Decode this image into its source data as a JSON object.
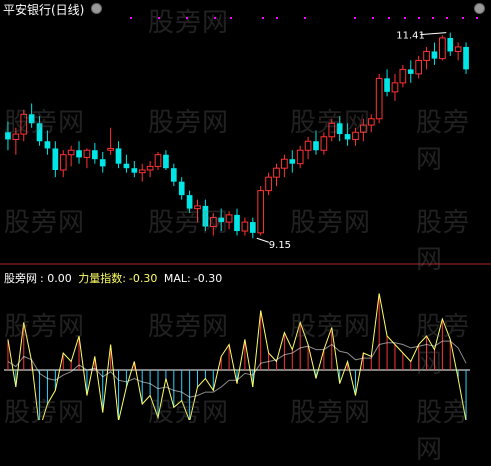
{
  "header": {
    "title": "平安银行(日线)",
    "watermark": "股旁网",
    "high_label": "11.41",
    "low_label": "9.15"
  },
  "indicator_bar": {
    "name": "股旁网",
    "value_text": ": 0.00",
    "force_label": "力量指数:",
    "force_value": "-0.30",
    "mal_label": "MAL:",
    "mal_value": "-0.30"
  },
  "colors": {
    "background": "#000000",
    "up_candle": "#ff3333",
    "down_candle": "#00e5e5",
    "divider": "#b22222",
    "dotted_top": "#ff00ff",
    "force_line": "#ffff66",
    "force_bar_up": "#ff3333",
    "force_bar_down": "#2ad2ff"
  },
  "chart_data": [
    {
      "type": "candlestick",
      "title": "平安银行(日线)",
      "price_range": [
        8.9,
        11.55
      ],
      "annotations": [
        {
          "text": "11.41",
          "index": 56
        },
        {
          "text": "9.15",
          "index": 31
        }
      ],
      "ohlc": [
        [
          10.3,
          10.42,
          10.1,
          10.22
        ],
        [
          10.22,
          10.35,
          10.05,
          10.28
        ],
        [
          10.28,
          10.55,
          10.2,
          10.5
        ],
        [
          10.5,
          10.62,
          10.35,
          10.4
        ],
        [
          10.4,
          10.48,
          10.15,
          10.2
        ],
        [
          10.2,
          10.32,
          10.05,
          10.12
        ],
        [
          10.12,
          10.2,
          9.8,
          9.88
        ],
        [
          9.88,
          10.1,
          9.8,
          10.05
        ],
        [
          10.05,
          10.15,
          9.92,
          10.1
        ],
        [
          10.1,
          10.2,
          9.95,
          10.02
        ],
        [
          10.02,
          10.12,
          9.9,
          10.1
        ],
        [
          10.1,
          10.18,
          9.95,
          10.0
        ],
        [
          10.0,
          10.08,
          9.85,
          9.92
        ],
        [
          10.1,
          10.35,
          10.05,
          10.12
        ],
        [
          10.12,
          10.2,
          9.9,
          9.95
        ],
        [
          9.95,
          10.05,
          9.85,
          9.9
        ],
        [
          9.9,
          9.98,
          9.8,
          9.85
        ],
        [
          9.85,
          9.95,
          9.75,
          9.88
        ],
        [
          9.88,
          9.98,
          9.8,
          9.92
        ],
        [
          9.92,
          10.08,
          9.88,
          10.05
        ],
        [
          10.05,
          10.1,
          9.88,
          9.9
        ],
        [
          9.9,
          9.95,
          9.7,
          9.75
        ],
        [
          9.75,
          9.8,
          9.55,
          9.6
        ],
        [
          9.6,
          9.65,
          9.4,
          9.45
        ],
        [
          9.45,
          9.55,
          9.3,
          9.48
        ],
        [
          9.48,
          9.55,
          9.2,
          9.25
        ],
        [
          9.25,
          9.4,
          9.15,
          9.35
        ],
        [
          9.35,
          9.45,
          9.2,
          9.3
        ],
        [
          9.3,
          9.42,
          9.22,
          9.38
        ],
        [
          9.38,
          9.45,
          9.15,
          9.2
        ],
        [
          9.2,
          9.35,
          9.15,
          9.3
        ],
        [
          9.3,
          9.35,
          9.12,
          9.18
        ],
        [
          9.18,
          9.7,
          9.15,
          9.65
        ],
        [
          9.65,
          9.85,
          9.6,
          9.8
        ],
        [
          9.8,
          9.95,
          9.7,
          9.9
        ],
        [
          9.9,
          10.05,
          9.8,
          10.0
        ],
        [
          10.0,
          10.1,
          9.85,
          9.95
        ],
        [
          9.95,
          10.15,
          9.9,
          10.1
        ],
        [
          10.1,
          10.25,
          10.0,
          10.2
        ],
        [
          10.2,
          10.32,
          10.05,
          10.1
        ],
        [
          10.1,
          10.3,
          10.05,
          10.25
        ],
        [
          10.25,
          10.45,
          10.2,
          10.4
        ],
        [
          10.4,
          10.48,
          10.2,
          10.28
        ],
        [
          10.28,
          10.4,
          10.15,
          10.22
        ],
        [
          10.22,
          10.35,
          10.15,
          10.3
        ],
        [
          10.3,
          10.45,
          10.2,
          10.38
        ],
        [
          10.38,
          10.5,
          10.3,
          10.45
        ],
        [
          10.45,
          10.95,
          10.4,
          10.9
        ],
        [
          10.9,
          11.0,
          10.7,
          10.75
        ],
        [
          10.75,
          10.95,
          10.65,
          10.85
        ],
        [
          10.85,
          11.05,
          10.8,
          11.0
        ],
        [
          11.0,
          11.1,
          10.85,
          10.95
        ],
        [
          10.95,
          11.15,
          10.9,
          11.1
        ],
        [
          11.1,
          11.25,
          11.0,
          11.2
        ],
        [
          11.2,
          11.3,
          11.05,
          11.12
        ],
        [
          11.12,
          11.38,
          11.1,
          11.35
        ],
        [
          11.35,
          11.41,
          11.15,
          11.2
        ],
        [
          11.2,
          11.3,
          11.1,
          11.25
        ],
        [
          11.25,
          11.3,
          10.95,
          11.0
        ]
      ]
    },
    {
      "type": "bar",
      "title": "力量指数",
      "series": [
        {
          "name": "力量指数",
          "values": [
            0.18,
            -0.1,
            0.28,
            0.05,
            -0.35,
            -0.2,
            -0.12,
            0.1,
            0.05,
            0.2,
            -0.15,
            0.08,
            -0.25,
            0.15,
            -0.3,
            -0.1,
            0.05,
            -0.2,
            -0.15,
            -0.28,
            -0.05,
            -0.22,
            -0.18,
            -0.3,
            -0.1,
            -0.05,
            -0.12,
            0.08,
            0.15,
            -0.08,
            0.18,
            -0.1,
            0.35,
            0.1,
            0.05,
            0.22,
            0.12,
            0.28,
            0.15,
            -0.05,
            0.12,
            0.25,
            -0.08,
            0.05,
            -0.15,
            0.1,
            0.08,
            0.45,
            0.2,
            0.15,
            0.1,
            0.05,
            0.15,
            0.2,
            0.12,
            0.3,
            0.18,
            -0.05,
            -0.3
          ]
        },
        {
          "name": "MAL",
          "values": [
            0.05,
            0.02,
            0.08,
            0.06,
            -0.02,
            -0.05,
            -0.06,
            -0.03,
            -0.01,
            0.03,
            0.0,
            0.01,
            -0.04,
            -0.01,
            -0.06,
            -0.07,
            -0.05,
            -0.07,
            -0.08,
            -0.11,
            -0.1,
            -0.12,
            -0.13,
            -0.16,
            -0.15,
            -0.13,
            -0.13,
            -0.1,
            -0.06,
            -0.06,
            -0.02,
            -0.03,
            0.04,
            0.05,
            0.06,
            0.09,
            0.1,
            0.13,
            0.14,
            0.12,
            0.12,
            0.15,
            0.11,
            0.1,
            0.06,
            0.07,
            0.07,
            0.15,
            0.16,
            0.16,
            0.15,
            0.13,
            0.14,
            0.15,
            0.14,
            0.17,
            0.17,
            0.13,
            0.04
          ]
        }
      ]
    }
  ]
}
